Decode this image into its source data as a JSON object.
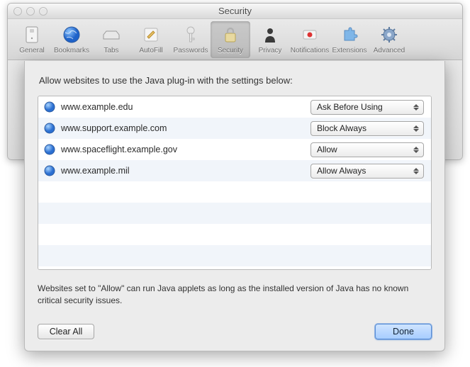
{
  "window": {
    "title": "Security"
  },
  "toolbar": {
    "items": [
      {
        "label": "General"
      },
      {
        "label": "Bookmarks"
      },
      {
        "label": "Tabs"
      },
      {
        "label": "AutoFill"
      },
      {
        "label": "Passwords"
      },
      {
        "label": "Security"
      },
      {
        "label": "Privacy"
      },
      {
        "label": "Notifications"
      },
      {
        "label": "Extensions"
      },
      {
        "label": "Advanced"
      }
    ]
  },
  "sheet": {
    "heading": "Allow websites to use the Java plug-in with the settings below:",
    "rows": [
      {
        "site": "www.example.edu",
        "setting": "Ask Before Using"
      },
      {
        "site": "www.support.example.com",
        "setting": "Block Always"
      },
      {
        "site": "www.spaceflight.example.gov",
        "setting": "Allow"
      },
      {
        "site": "www.example.mil",
        "setting": "Allow Always"
      }
    ],
    "note": "Websites set to \"Allow\" can run Java applets as long as the installed version of Java has no known critical security issues.",
    "clear_label": "Clear All",
    "done_label": "Done"
  }
}
